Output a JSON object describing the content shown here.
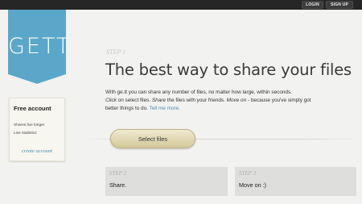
{
  "header": {
    "login": "LOGIN",
    "signup": "SIGN UP"
  },
  "logo": {
    "text": "GETT",
    "color": "#5ba7c9"
  },
  "account": {
    "title": "Free account",
    "features": [
      "Shares live longer",
      "Live statistics"
    ],
    "create_link": "create account"
  },
  "main": {
    "step_label": "STEP 1",
    "headline": "The best way to share your files",
    "desc_line1": "With ge.tt you can share any number of files, no matter how large, within seconds.",
    "desc_line2_a": "Click",
    "desc_line2_b": " on select files. ",
    "desc_line2_c": "Share",
    "desc_line2_d": " the files with your friends. ",
    "desc_line2_e": "Move on",
    "desc_line2_f": " - because you've simply got",
    "desc_line3": "better things to do.",
    "tell_more": "Tell me more.",
    "select_button": "Select files"
  },
  "steps": [
    {
      "label": "STEP 2",
      "text": "Share."
    },
    {
      "label": "STEP 3",
      "text": "Move on :)"
    }
  ]
}
